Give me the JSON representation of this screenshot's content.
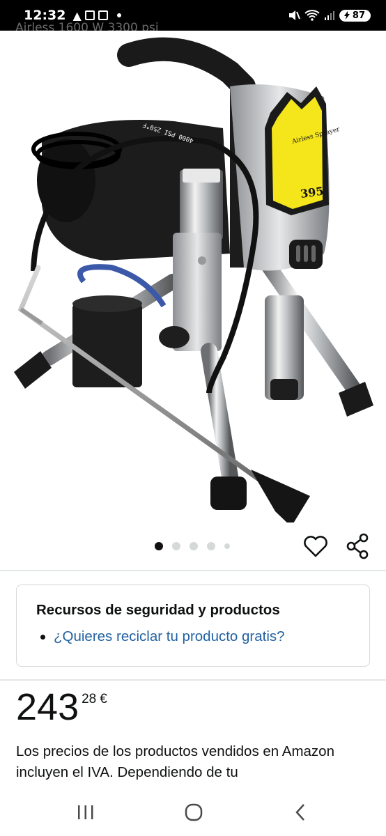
{
  "status_bar": {
    "time": "12:32",
    "battery": "87"
  },
  "header": {
    "peek_title": "Airless 1600 W 3300 psi"
  },
  "product": {
    "image_text": {
      "brand": "Airless Sprayer",
      "model": "395",
      "hose_label_top": "4000 PSI 250°F",
      "hose_label_side": "4000 PSI 250°F"
    },
    "carousel": {
      "total": 5,
      "active_index": 0
    }
  },
  "safety": {
    "title": "Recursos de seguridad y productos",
    "link": "¿Quieres reciclar tu producto gratis?"
  },
  "price": {
    "whole": "243",
    "fraction": "28",
    "currency": "€"
  },
  "tax_text": "Los precios de los productos vendidos en Amazon incluyen el IVA. Dependiendo de tu",
  "colors": {
    "link": "#2162a1",
    "sprayer_yellow": "#f5e61c",
    "text": "#0f1111"
  }
}
